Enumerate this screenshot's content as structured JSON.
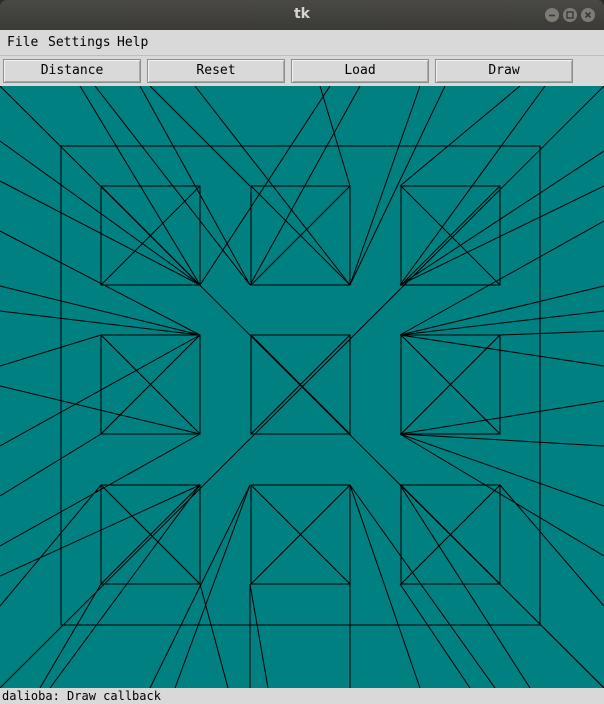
{
  "window": {
    "title": "tk"
  },
  "menubar": {
    "items": [
      "File",
      "Settings",
      "Help"
    ]
  },
  "toolbar": {
    "buttons": [
      "Distance",
      "Reset",
      "Load",
      "Draw"
    ]
  },
  "canvas": {
    "background": "#008080",
    "stroke": "#000000"
  },
  "status": {
    "text": "dalioba: Draw callback"
  }
}
